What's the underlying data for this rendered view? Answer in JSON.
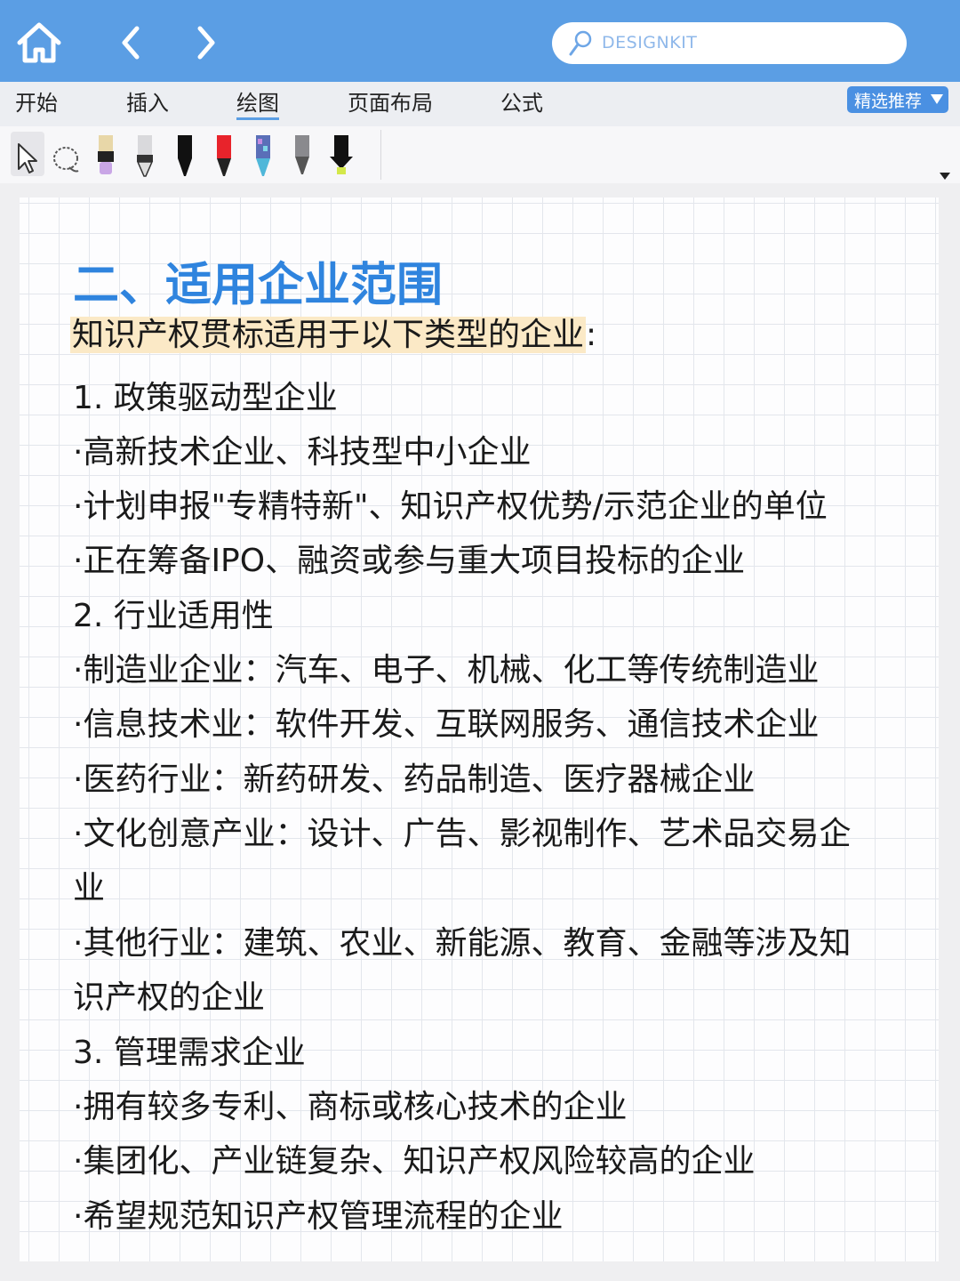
{
  "search": {
    "placeholder": "DESIGNKIT"
  },
  "menu": {
    "items": [
      "开始",
      "插入",
      "绘图",
      "页面布局",
      "公式"
    ],
    "active": "绘图",
    "recommend_label": "精选推荐"
  },
  "toolbar": {
    "tools": [
      "select-tool",
      "lasso-tool",
      "highlighter-purple",
      "pencil-gray",
      "pen-black",
      "pen-red",
      "pen-galaxy",
      "pen-gray-fine",
      "highlighter-yellow"
    ]
  },
  "colors": {
    "topbar": "#5b9ee4",
    "heading": "#2f84de",
    "highlight": "#fbe9c6"
  },
  "document": {
    "heading": "二、适用企业范围",
    "intro_highlight": "知识产权贯标适用于以下类型的企业",
    "intro_suffix": ":",
    "lines": [
      "1. 政策驱动型企业",
      "·高新技术企业、科技型中小企业",
      "·计划申报\"专精特新\"、知识产权优势/示范企业的单位",
      "·正在筹备IPO、融资或参与重大项目投标的企业",
      "2. 行业适用性",
      "·制造业企业：汽车、电子、机械、化工等传统制造业",
      "·信息技术业：软件开发、互联网服务、通信技术企业",
      "·医药行业：新药研发、药品制造、医疗器械企业",
      "·文化创意产业：设计、广告、影视制作、艺术品交易企",
      "业",
      "·其他行业：建筑、农业、新能源、教育、金融等涉及知",
      "识产权的企业",
      "3. 管理需求企业",
      "·拥有较多专利、商标或核心技术的企业",
      "·集团化、产业链复杂、知识产权风险较高的企业",
      "·希望规范知识产权管理流程的企业"
    ]
  }
}
